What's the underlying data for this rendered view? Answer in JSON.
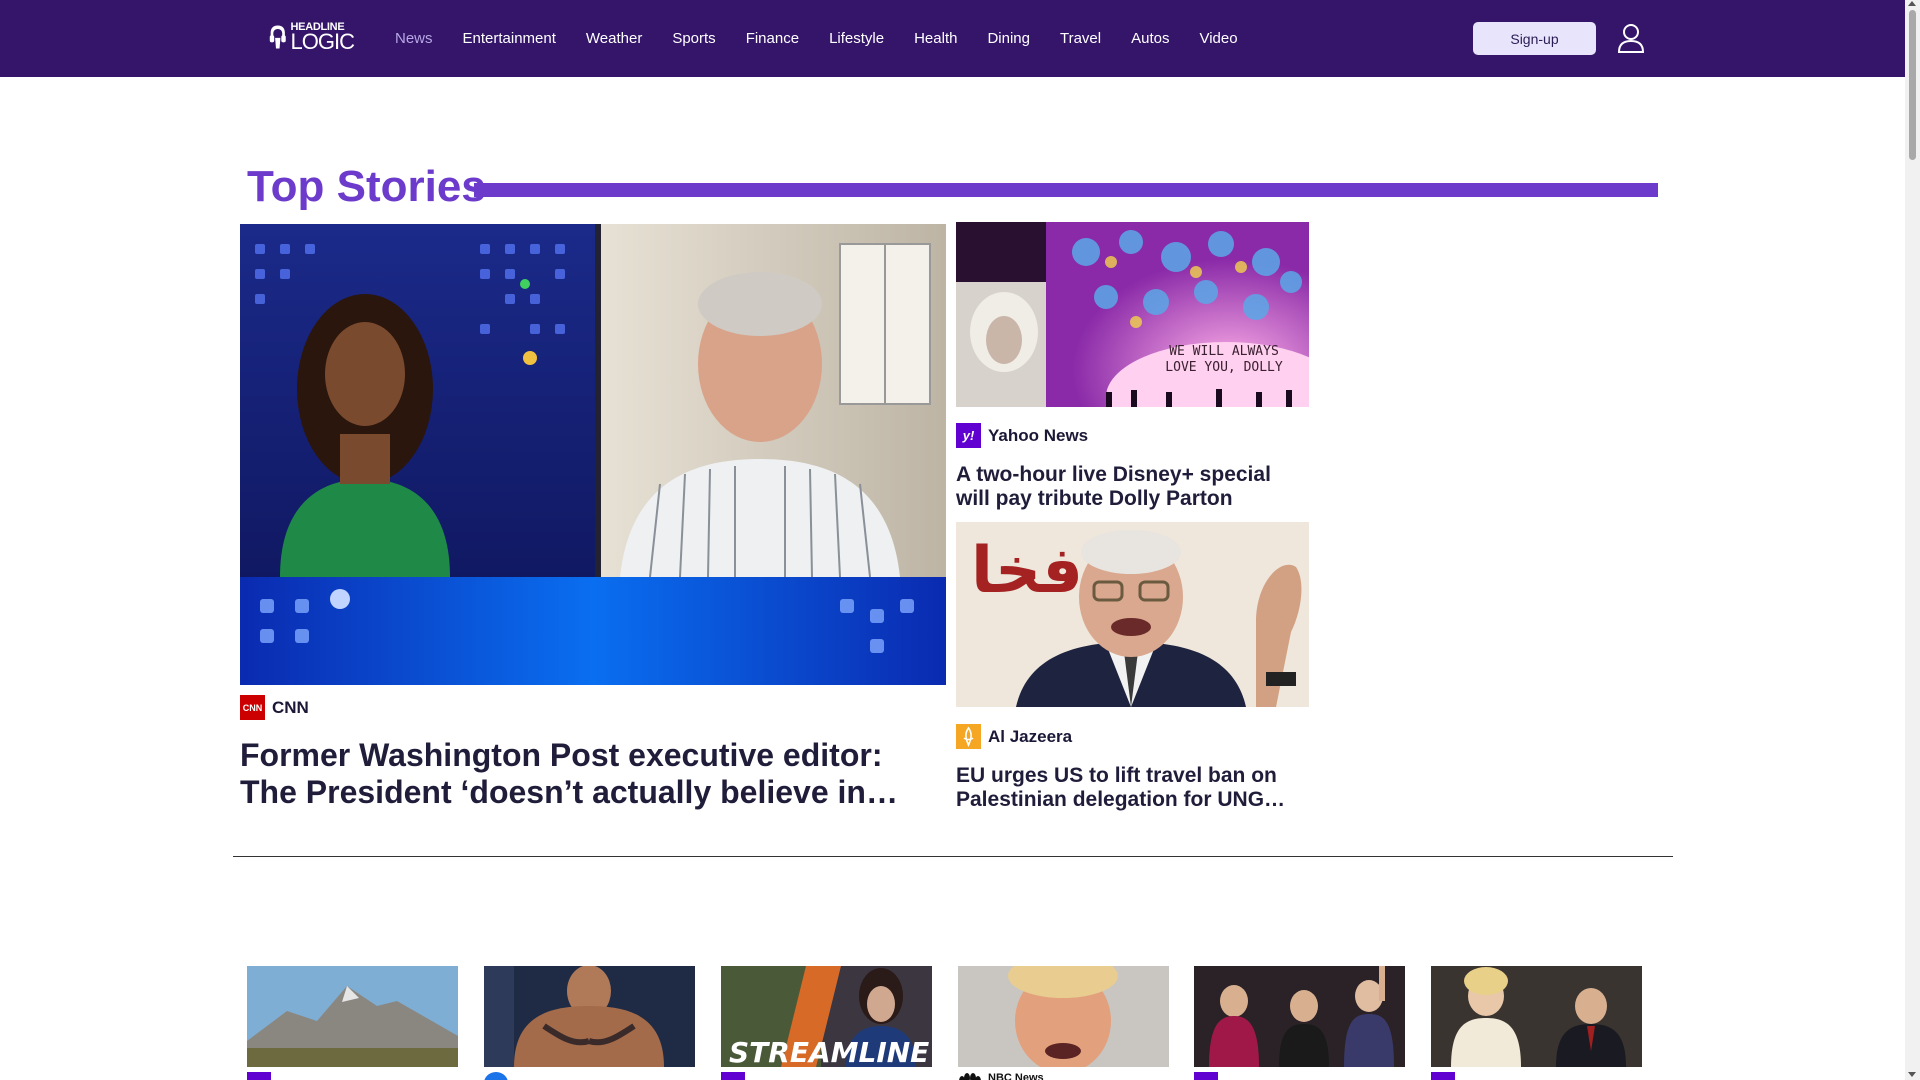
{
  "brand": {
    "line1": "HEADLINE",
    "line2": "LOGIC"
  },
  "nav": {
    "items": [
      "News",
      "Entertainment",
      "Weather",
      "Sports",
      "Finance",
      "Lifestyle",
      "Health",
      "Dining",
      "Travel",
      "Autos",
      "Video"
    ],
    "active": "News",
    "signup_label": "Sign-up"
  },
  "section": {
    "title": "Top Stories"
  },
  "hero": {
    "source": "CNN",
    "source_logo_text": "CNN",
    "title": "Former Washington Post executive editor: The President ‘doesn’t actually believe in…"
  },
  "side_stories": [
    {
      "source": "Yahoo News",
      "source_logo_text": "y!",
      "title": "A two-hour live Disney+ special will pay tribute Dolly Parton this…",
      "image_text_1": "WE WILL ALWAYS",
      "image_text_2": "LOVE YOU, DOLLY"
    },
    {
      "source": "Al Jazeera",
      "source_logo_text": "",
      "title": "EU urges US to lift travel ban on Palestinian delegation for UNG…",
      "image_text_1": "فخا"
    }
  ],
  "thumbs": [
    {
      "source_logo": "yahoo-logo"
    },
    {
      "source_logo": "blue-circle-logo"
    },
    {
      "source_logo": "yahoo-logo",
      "image_text": "STREAMLINE"
    },
    {
      "source_logo": "nbc-peacock-logo",
      "source": "NBC News"
    },
    {
      "source_logo": "yahoo-logo"
    },
    {
      "source_logo": "yahoo-logo"
    }
  ],
  "colors": {
    "topbar": "#35156a",
    "accent": "#6c3bcc",
    "nav_active": "#b7a7e4",
    "cnn_red": "#cc0000",
    "yahoo_purple": "#6001d2",
    "aljazeera_orange": "#f5a623"
  }
}
